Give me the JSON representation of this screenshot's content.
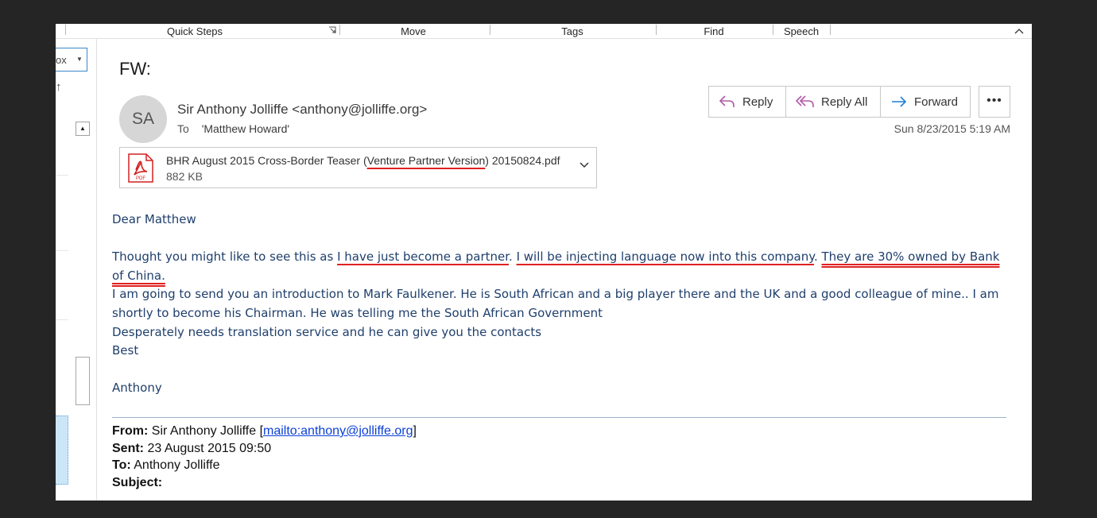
{
  "ribbon": {
    "groups": [
      "Quick Steps",
      "Move",
      "Tags",
      "Find",
      "Speech"
    ]
  },
  "left_pane": {
    "folder_combo": "ox",
    "sort_arrow": "↑"
  },
  "message": {
    "subject": "FW:",
    "avatar_initials": "SA",
    "sender": "Sir Anthony Jolliffe <anthony@jolliffe.org>",
    "to_label": "To",
    "to_value": "'Matthew Howard'",
    "date": "Sun 8/23/2015 5:19 AM",
    "actions": {
      "reply": "Reply",
      "reply_all": "Reply All",
      "forward": "Forward",
      "more": "•••"
    },
    "attachment": {
      "name_pre": "BHR August 2015 Cross-Border Teaser (",
      "name_underlined": "Venture Partner Version",
      "name_post": ") 20150824.pdf",
      "size": "882 KB",
      "icon_label": "PDF"
    }
  },
  "body": {
    "greeting": "Dear Matthew",
    "para1_a": "Thought you might like to see this as ",
    "para1_u1": "I have just become a partner",
    "para1_b": ".  ",
    "para1_u2": "I will be injecting language now into this company",
    "para1_c": ". ",
    "para1_u3": "They are 30% owned by Bank of China.",
    "line2": "I am going to send you an introduction to Mark Faulkener. He is South African and a big player there and the UK and a good colleague of mine.. I am shortly to become his Chairman. He was telling me the South African Government",
    "line3": "Desperately needs translation service and he can give you the contacts",
    "closing": "Best",
    "signature": "Anthony"
  },
  "forwarded": {
    "from_label": "From:",
    "from_value": "Sir Anthony Jolliffe [",
    "from_link": "mailto:anthony@jolliffe.org",
    "from_end": "]",
    "sent_label": "Sent:",
    "sent_value": "23 August 2015 09:50",
    "to_label": "To:",
    "to_value": "Anthony Jolliffe",
    "subject_label": "Subject:",
    "subject_value": ""
  },
  "colors": {
    "body_text": "#1f3f6c",
    "underline": "#e02020",
    "link": "#0b3fd6",
    "reply_icon": "#b05aa8",
    "forward_icon": "#1e7fd8",
    "pdf_red": "#d32020"
  }
}
